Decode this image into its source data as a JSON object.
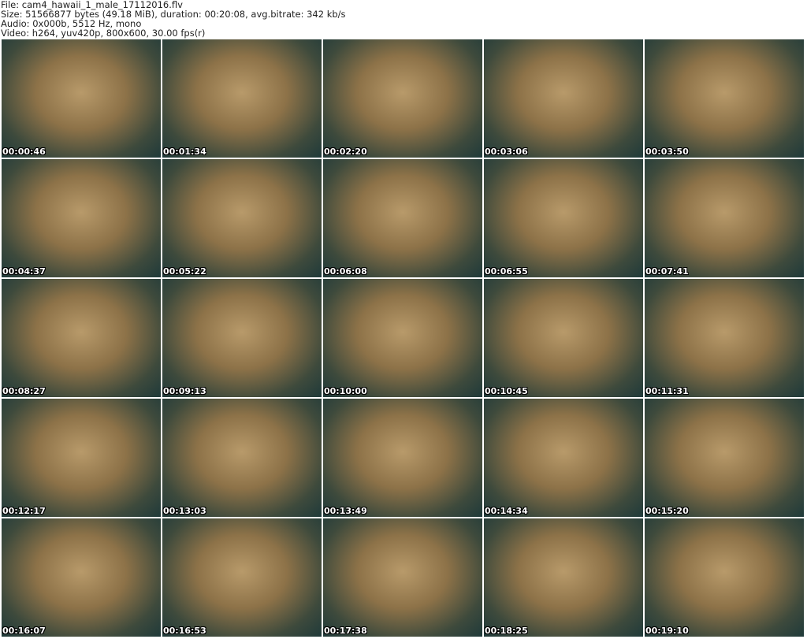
{
  "header": {
    "file": "File: cam4_hawaii_1_male_17112016.flv",
    "size": "Size: 51566877 bytes (49.18 MiB), duration: 00:20:08, avg.bitrate: 342 kb/s",
    "audio": "Audio: 0x000b, 5512 Hz, mono",
    "video": "Video: h264, yuv420p, 800x600, 30.00 fps(r)"
  },
  "thumbnails": [
    "00:00:46",
    "00:01:34",
    "00:02:20",
    "00:03:06",
    "00:03:50",
    "00:04:37",
    "00:05:22",
    "00:06:08",
    "00:06:55",
    "00:07:41",
    "00:08:27",
    "00:09:13",
    "00:10:00",
    "00:10:45",
    "00:11:31",
    "00:12:17",
    "00:13:03",
    "00:13:49",
    "00:14:34",
    "00:15:20",
    "00:16:07",
    "00:16:53",
    "00:17:38",
    "00:18:25",
    "00:19:10"
  ]
}
